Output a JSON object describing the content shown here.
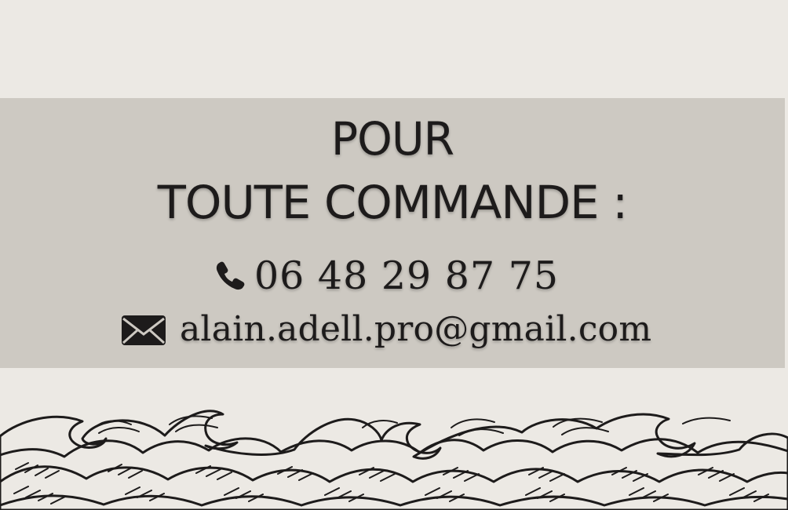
{
  "heading": {
    "line1": "POUR",
    "line2": "TOUTE COMMANDE :"
  },
  "contact": {
    "phone": "06 48 29 87 75",
    "email": "alain.adell.pro@gmail.com"
  },
  "icons": {
    "phone": "phone-icon",
    "email": "envelope-icon",
    "decoration": "waves-illustration"
  },
  "colors": {
    "page_background": "#ece9e4",
    "band_background": "#cdc9c2",
    "text": "#1d1b1b"
  }
}
